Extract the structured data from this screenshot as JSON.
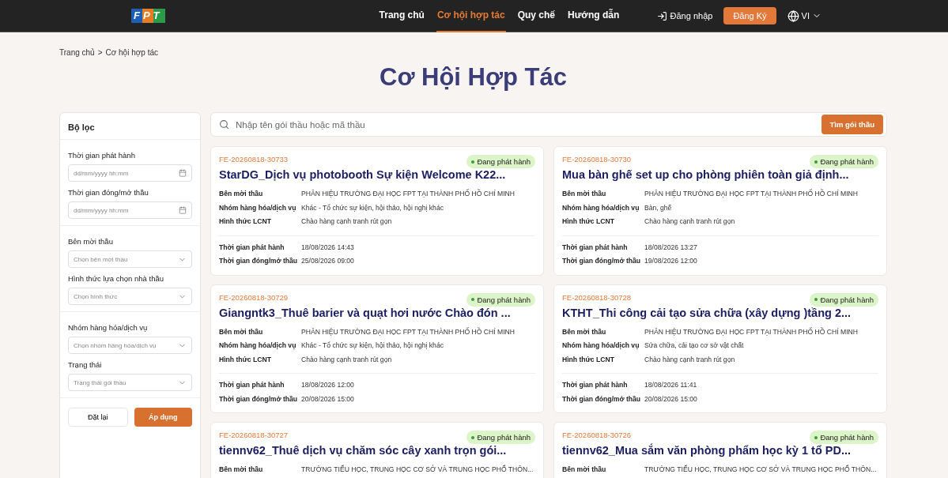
{
  "header": {
    "logo": "FPT",
    "nav": [
      {
        "label": "Trang chủ",
        "selected": false
      },
      {
        "label": "Cơ hội hợp tác",
        "selected": true
      },
      {
        "label": "Quy chế",
        "selected": false
      },
      {
        "label": "Hướng dẫn",
        "selected": false
      }
    ],
    "login": "Đăng nhập",
    "register": "Đăng Ký",
    "language": "VI"
  },
  "breadcrumb": {
    "items": [
      "Trang chủ",
      "Cơ hội hợp tác"
    ],
    "separator": ">"
  },
  "title": "Cơ Hội Hợp Tác",
  "filter": {
    "title": "Bộ lọc",
    "groups": [
      [
        {
          "kind": "date",
          "label": "Thời gian phát hành",
          "placeholder": "dd/mm/yyyy hh:mm"
        },
        {
          "kind": "date",
          "label": "Thời gian đóng/mở thầu",
          "placeholder": "dd/mm/yyyy hh:mm"
        }
      ],
      [
        {
          "kind": "select",
          "label": "Bên mời thầu",
          "placeholder": "Chọn bên mời thầu"
        },
        {
          "kind": "select",
          "label": "Hình thức lựa chọn nhà thầu",
          "placeholder": "Chọn hình thức"
        }
      ],
      [
        {
          "kind": "select",
          "label": "Nhóm hàng hóa/dịch vụ",
          "placeholder": "Chọn nhóm hàng hóa/dịch vụ"
        },
        {
          "kind": "select",
          "label": "Trạng thái",
          "placeholder": "Trạng thái gói thầu"
        }
      ]
    ],
    "reset": "Đặt lại",
    "apply": "Áp dụng"
  },
  "search": {
    "placeholder": "Nhập tên gói thầu hoặc mã thầu",
    "button": "Tìm gói thầu"
  },
  "cards": [
    {
      "code": "FE-20260818-30733",
      "status": "Đang phát hành",
      "title": "StarDG_Dịch vụ photobooth Sự kiện Welcome K22...",
      "fields": [
        [
          "Bên mời thầu",
          "PHÂN HIỆU TRƯỜNG ĐẠI HỌC FPT TẠI THÀNH PHỐ HỒ CHÍ MINH"
        ],
        [
          "Nhóm hàng hóa/dịch vụ",
          "Khác - Tổ chức sự kiện, hội thảo, hội nghị khác"
        ],
        [
          "Hình thức LCNT",
          "Chào hàng cạnh tranh rút gọn"
        ]
      ],
      "times": [
        [
          "Thời gian phát hành",
          "18/08/2026 14:43"
        ],
        [
          "Thời gian đóng/mở thầu",
          "25/08/2026 09:00"
        ]
      ]
    },
    {
      "code": "FE-20260818-30730",
      "status": "Đang phát hành",
      "title": "Mua bàn ghế set up cho phòng phiên toàn giả định...",
      "fields": [
        [
          "Bên mời thầu",
          "PHÂN HIỆU TRƯỜNG ĐẠI HỌC FPT TẠI THÀNH PHỐ HỒ CHÍ MINH"
        ],
        [
          "Nhóm hàng hóa/dịch vụ",
          "Bàn, ghế"
        ],
        [
          "Hình thức LCNT",
          "Chào hàng cạnh tranh rút gọn"
        ]
      ],
      "times": [
        [
          "Thời gian phát hành",
          "18/08/2026 13:27"
        ],
        [
          "Thời gian đóng/mở thầu",
          "19/08/2026 12:00"
        ]
      ]
    },
    {
      "code": "FE-20260818-30729",
      "status": "Đang phát hành",
      "title": "Giangntk3_Thuê barier và quạt hơi nước Chào đón ...",
      "fields": [
        [
          "Bên mời thầu",
          "PHÂN HIỆU TRƯỜNG ĐẠI HỌC FPT TẠI THÀNH PHỐ HỒ CHÍ MINH"
        ],
        [
          "Nhóm hàng hóa/dịch vụ",
          "Khác - Tổ chức sự kiện, hội thảo, hội nghị khác"
        ],
        [
          "Hình thức LCNT",
          "Chào hàng cạnh tranh rút gọn"
        ]
      ],
      "times": [
        [
          "Thời gian phát hành",
          "18/08/2026 12:00"
        ],
        [
          "Thời gian đóng/mở thầu",
          "20/08/2026 15:00"
        ]
      ]
    },
    {
      "code": "FE-20260818-30728",
      "status": "Đang phát hành",
      "title": "KTHT_Thi công cải tạo sửa chữa (xây dựng )tầng 2...",
      "fields": [
        [
          "Bên mời thầu",
          "PHÂN HIỆU TRƯỜNG ĐẠI HỌC FPT TẠI THÀNH PHỐ HỒ CHÍ MINH"
        ],
        [
          "Nhóm hàng hóa/dịch vụ",
          "Sửa chữa, cải tạo cơ sở vật chất"
        ],
        [
          "Hình thức LCNT",
          "Chào hàng cạnh tranh rút gọn"
        ]
      ],
      "times": [
        [
          "Thời gian phát hành",
          "18/08/2026 11:41"
        ],
        [
          "Thời gian đóng/mở thầu",
          "20/08/2026 15:00"
        ]
      ]
    },
    {
      "code": "FE-20260818-30727",
      "status": "Đang phát hành",
      "title": "tiennv62_Thuê dịch vụ chăm sóc cây xanh trọn gói...",
      "fields": [
        [
          "Bên mời thầu",
          "TRƯỜNG TIỂU HỌC, TRUNG HỌC CƠ SỞ VÀ TRUNG HỌC PHỔ THÔN..."
        ]
      ]
    },
    {
      "code": "FE-20260818-30726",
      "status": "Đang phát hành",
      "title": "tiennv62_Mua sắm văn phòng phẩm học kỳ 1 tổ PD...",
      "fields": [
        [
          "Bên mời thầu",
          "TRƯỜNG TIỂU HỌC, TRUNG HỌC CƠ SỞ VÀ TRUNG HỌC PHỔ THÔN..."
        ]
      ]
    }
  ]
}
